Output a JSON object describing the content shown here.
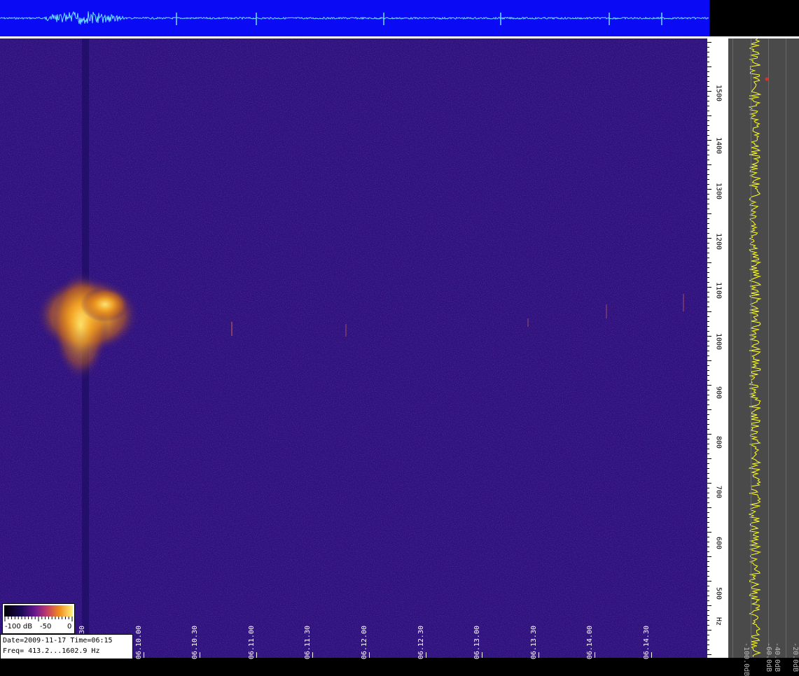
{
  "info": {
    "date_time": "Date=2009-11-17 Time=06:15",
    "freq_range": "Freq= 413.2...1602.9 Hz"
  },
  "colorbar": {
    "label_min": "-100 dB",
    "label_mid": "-50",
    "label_max": "0"
  },
  "freq_axis": {
    "unit_label": "Hz",
    "labels": [
      "1500",
      "1400",
      "1300",
      "1200",
      "1100",
      "1000",
      "900",
      "800",
      "700",
      "600",
      "500"
    ]
  },
  "time_axis": {
    "labels": [
      "30",
      "06.10.00",
      "06.10.30",
      "06.11.00",
      "06.11.30",
      "06.12.00",
      "06.12.30",
      "06.13.00",
      "06.13.30",
      "06.14.00",
      "06.14.30"
    ]
  },
  "spectrum_scale": {
    "labels": [
      "-100.0dB",
      "-60.0dB",
      "-40.0dB",
      "-20.0dB"
    ]
  },
  "colors": {
    "waveform_bg": "#0a0bf4",
    "waveform_trace": "#6fe2ff",
    "spectrogram_bg": "#2d127e",
    "signal_hot": "#f6a623",
    "spectrum_trace": "#ffff2a"
  }
}
